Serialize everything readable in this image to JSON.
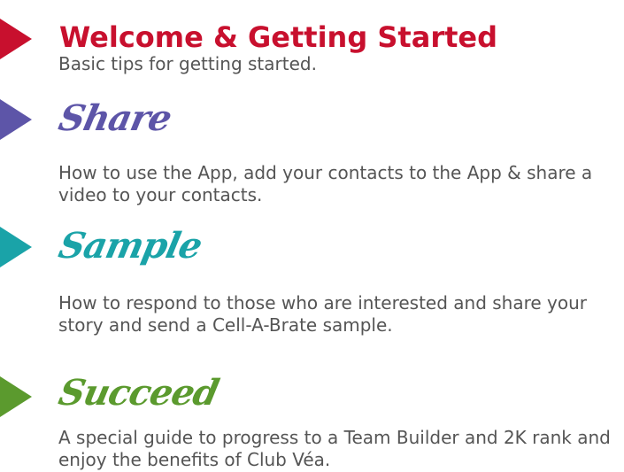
{
  "colors": {
    "welcome": "#c8102e",
    "share": "#5d55a8",
    "sample": "#1aa3a8",
    "succeed": "#5b9a2e",
    "description": "#555555"
  },
  "sections": [
    {
      "title": "Welcome & Getting Started",
      "description": "Basic tips for getting started."
    },
    {
      "title": "Share",
      "description": "How to use the App, add your contacts to the App & share a video to your contacts."
    },
    {
      "title": "Sample",
      "description": "How to respond to those who are interested and share your story and send a Cell-A-Brate sample."
    },
    {
      "title": "Succeed",
      "description": "A special guide to progress to a Team Builder and 2K rank and enjoy the benefits of Club Véa."
    }
  ]
}
